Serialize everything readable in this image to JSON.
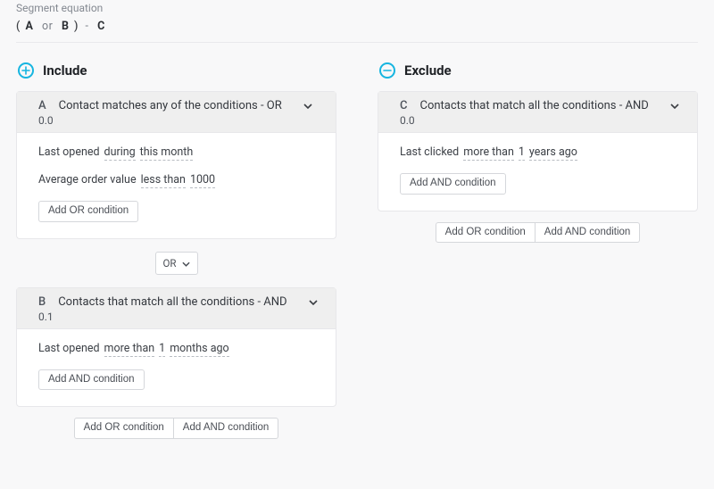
{
  "segment": {
    "label": "Segment equation",
    "tokens": [
      "(",
      "A",
      "or",
      "B",
      ")",
      "-",
      "C"
    ]
  },
  "include": {
    "title": "Include",
    "groups": [
      {
        "letter": "A",
        "title": "Contact matches any of the conditions - OR",
        "sub": "0.0",
        "conditions": [
          {
            "parts": [
              {
                "t": "Last opened",
                "v": false
              },
              {
                "t": "during",
                "v": true
              },
              {
                "t": "this month",
                "v": true
              }
            ]
          },
          {
            "parts": [
              {
                "t": "Average order value",
                "v": false
              },
              {
                "t": "less than",
                "v": true
              },
              {
                "t": "1000",
                "v": true
              }
            ]
          }
        ],
        "add_label": "Add OR condition"
      },
      {
        "letter": "B",
        "title": "Contacts that match all the conditions - AND",
        "sub": "0.1",
        "conditions": [
          {
            "parts": [
              {
                "t": "Last opened",
                "v": false
              },
              {
                "t": "more than",
                "v": true
              },
              {
                "t": "1",
                "v": true
              },
              {
                "t": "months ago",
                "v": true
              }
            ]
          }
        ],
        "add_label": "Add AND condition"
      }
    ],
    "connector": "OR",
    "footer": {
      "or": "Add OR condition",
      "and": "Add AND condition"
    }
  },
  "exclude": {
    "title": "Exclude",
    "groups": [
      {
        "letter": "C",
        "title": "Contacts that match all the conditions - AND",
        "sub": "0.0",
        "conditions": [
          {
            "parts": [
              {
                "t": "Last clicked",
                "v": false
              },
              {
                "t": "more than",
                "v": true
              },
              {
                "t": "1",
                "v": true
              },
              {
                "t": "years ago",
                "v": true
              }
            ]
          }
        ],
        "add_label": "Add AND condition"
      }
    ],
    "footer": {
      "or": "Add OR condition",
      "and": "Add AND condition"
    }
  }
}
